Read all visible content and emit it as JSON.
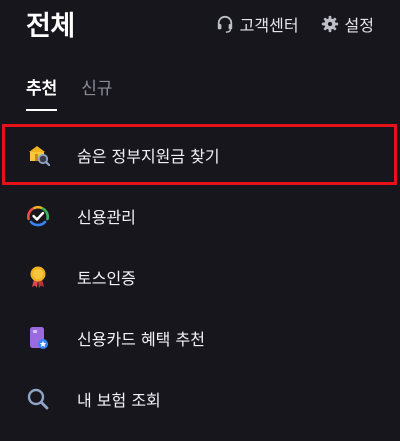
{
  "header": {
    "title": "전체",
    "support_label": "고객센터",
    "settings_label": "설정"
  },
  "tabs": [
    {
      "label": "추천",
      "active": true
    },
    {
      "label": "신규",
      "active": false
    }
  ],
  "menu": {
    "items": [
      {
        "label": "숨은 정부지원금 찾기",
        "icon": "government-subsidy-search-icon",
        "highlighted": true
      },
      {
        "label": "신용관리",
        "icon": "credit-gauge-icon",
        "highlighted": false
      },
      {
        "label": "토스인증",
        "icon": "certification-medal-icon",
        "highlighted": false
      },
      {
        "label": "신용카드 혜택 추천",
        "icon": "credit-card-star-icon",
        "highlighted": false
      },
      {
        "label": "내 보험 조회",
        "icon": "search-icon",
        "highlighted": false
      }
    ]
  },
  "colors": {
    "background": "#16161c",
    "highlight_border": "#e8101a",
    "text_primary": "#ffffff",
    "text_muted": "#8b8b95"
  }
}
